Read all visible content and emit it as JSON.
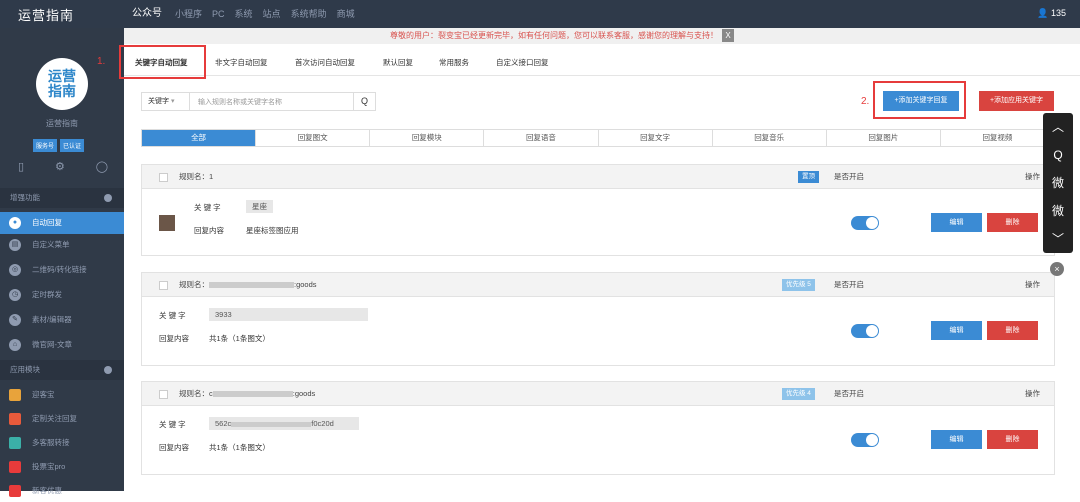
{
  "topbar": {
    "logo": "运营指南",
    "nav": [
      "公众号",
      "小程序",
      "PC",
      "系统",
      "站点",
      "系统帮助",
      "商城"
    ],
    "user": "135"
  },
  "notice": {
    "text": "尊敬的用户：裂变宝已经更新完毕，如有任何问题，您可以联系客服，感谢您的理解与支持！",
    "close": "X"
  },
  "sidebar": {
    "avatar_line1": "运营",
    "avatar_line2": "指南",
    "name": "运营指南",
    "badge1": "服务号",
    "badge2": "已认证",
    "sec1": "增强功能",
    "items1": [
      "自动回复",
      "自定义菜单",
      "二维码/转化链接",
      "定时群发",
      "素材/编辑器",
      "微官网-文章"
    ],
    "sec2": "应用模块",
    "items2": [
      "迎客宝",
      "定制关注回复",
      "多客服转接",
      "投票宝pro",
      "新客优惠"
    ]
  },
  "tabs": [
    "关键字自动回复",
    "非文字自动回复",
    "首次访问自动回复",
    "默认回复",
    "常用服务",
    "自定义接口回复"
  ],
  "marks": {
    "m1": "1.",
    "m2": "2."
  },
  "search": {
    "select": "关键字",
    "placeholder": "输入规则名称或关键字名称",
    "btn": "Q"
  },
  "buttons": {
    "add_keyword": "+添加关键字回复",
    "add_app_keyword": "+添加应用关键字"
  },
  "filters": [
    "全部",
    "回复图文",
    "回复模块",
    "回复语音",
    "回复文字",
    "回复音乐",
    "回复图片",
    "回复视频"
  ],
  "cards": [
    {
      "rule": "规则名：1",
      "tag": "置顶",
      "on": "是否开启",
      "op": "操作",
      "k_label": "关 键 字",
      "k_value": "星座",
      "c_label": "回复内容",
      "c_value": "星座标签图应用",
      "edit": "编辑",
      "del": "删除"
    },
    {
      "rule": "规则名：",
      "rule_tail": ":goods",
      "tag": "优先级 5",
      "on": "是否开启",
      "op": "操作",
      "k_label": "关 键 字",
      "k_value": "3933",
      "c_label": "回复内容",
      "c_value": "共1条（1条图文）",
      "edit": "编辑",
      "del": "删除"
    },
    {
      "rule": "规则名：c",
      "rule_tail": ":goods",
      "tag": "优先级 4",
      "on": "是否开启",
      "op": "操作",
      "k_label": "关 键 字",
      "k_value": "562c",
      "k_tail": "f0c20d",
      "c_label": "回复内容",
      "c_value": "共1条（1条图文）",
      "edit": "编辑",
      "del": "删除"
    }
  ],
  "float": [
    "︿",
    "Q",
    "微",
    "微",
    "﹀"
  ],
  "float_close": "×"
}
